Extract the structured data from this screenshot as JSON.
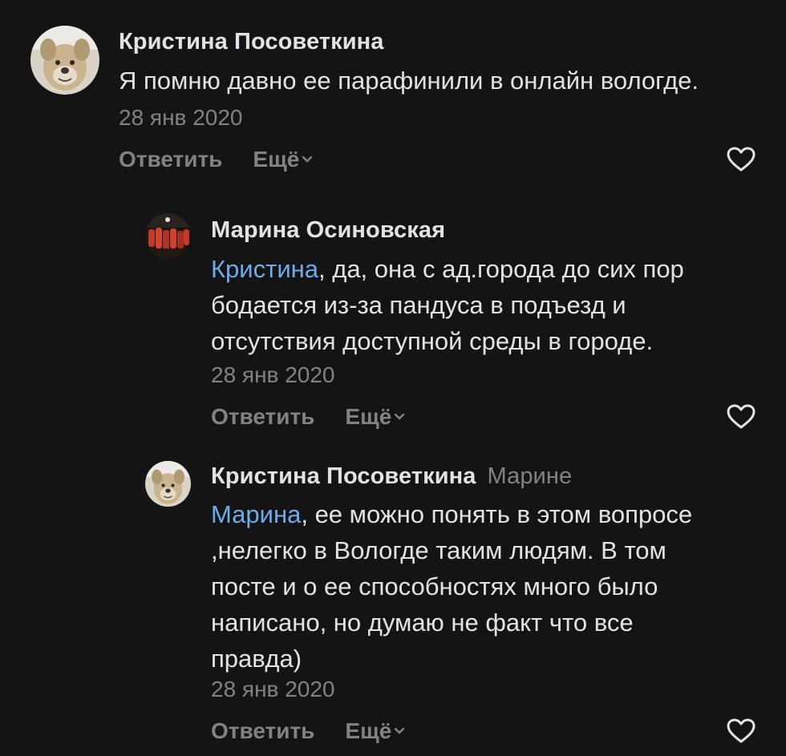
{
  "comments": [
    {
      "author": "Кристина Посоветкина",
      "reply_to": "",
      "mention": "",
      "text": "Я помню давно ее парафинили в онлайн вологде.",
      "date": "28 янв 2020",
      "reply_label": "Ответить",
      "more_label": "Ещё",
      "avatar_icon": "dog-photo-avatar",
      "like_icon": "heart-outline-icon"
    },
    {
      "author": "Марина Осиновская",
      "reply_to": "",
      "mention": "Кристина",
      "text": ", да, она с ад.города до сих пор\nбодается из-за пандуса в подъезд и\nотсутствия доступной среды в городе.",
      "date": "28 янв 2020",
      "reply_label": "Ответить",
      "more_label": "Ещё",
      "avatar_icon": "crowd-photo-avatar",
      "like_icon": "heart-outline-icon"
    },
    {
      "author": "Кристина Посоветкина",
      "reply_to": "Марине",
      "mention": "Марина",
      "text": ", ее можно понять в этом вопросе\n,нелегко в Вологде таким людям. В том\nпосте и о ее способностях много было\nнаписано, но думаю не факт что все\nправда)",
      "date": "28 янв 2020",
      "reply_label": "Ответить",
      "more_label": "Ещё",
      "avatar_icon": "dog-photo-avatar",
      "like_icon": "heart-outline-icon"
    }
  ],
  "colors": {
    "background": "#141414",
    "text": "#e1e3e6",
    "secondary": "#828282",
    "mention": "#71aaeb"
  }
}
